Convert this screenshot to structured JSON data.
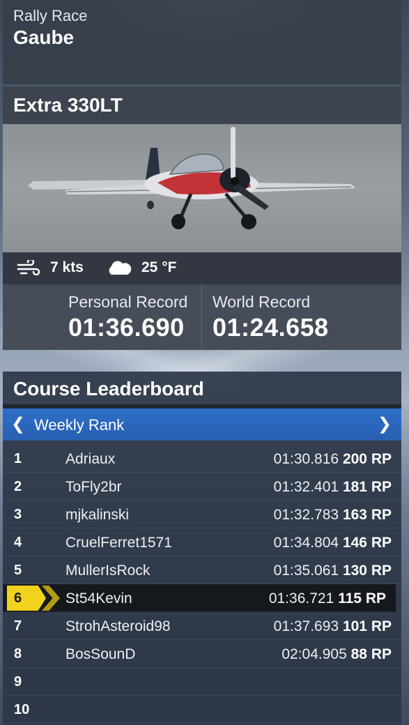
{
  "header": {
    "subtitle": "Rally Race",
    "title": "Gaube"
  },
  "aircraft": {
    "name": "Extra 330LT"
  },
  "weather": {
    "wind": {
      "icon": "wind-icon",
      "value": "7 kts"
    },
    "temperature": {
      "icon": "cloud-icon",
      "value": "25 °F"
    }
  },
  "records": {
    "personal": {
      "label": "Personal Record",
      "value": "01:36.690"
    },
    "world": {
      "label": "World Record",
      "value": "01:24.658"
    }
  },
  "leaderboard": {
    "title": "Course Leaderboard",
    "rank_type": "Weekly Rank",
    "rows": [
      {
        "rank": "1",
        "player": "Adriaux",
        "time": "01:30.816",
        "points": "200 RP"
      },
      {
        "rank": "2",
        "player": "ToFly2br",
        "time": "01:32.401",
        "points": "181 RP"
      },
      {
        "rank": "3",
        "player": "mjkalinski",
        "time": "01:32.783",
        "points": "163 RP"
      },
      {
        "rank": "4",
        "player": "CruelFerret1571",
        "time": "01:34.804",
        "points": "146 RP"
      },
      {
        "rank": "5",
        "player": "MullerIsRock",
        "time": "01:35.061",
        "points": "130 RP"
      },
      {
        "rank": "6",
        "player": "St54Kevin",
        "time": "01:36.721",
        "points": "115 RP"
      },
      {
        "rank": "7",
        "player": "StrohAsteroid98",
        "time": "01:37.693",
        "points": "101 RP"
      },
      {
        "rank": "8",
        "player": "BosSounD",
        "time": "02:04.905",
        "points": "88 RP"
      },
      {
        "rank": "9",
        "player": "",
        "time": "",
        "points": ""
      },
      {
        "rank": "10",
        "player": "",
        "time": "",
        "points": ""
      }
    ]
  },
  "colors": {
    "selector_blue": "#2f6fc9",
    "highlight_yellow": "#f1d21c"
  }
}
